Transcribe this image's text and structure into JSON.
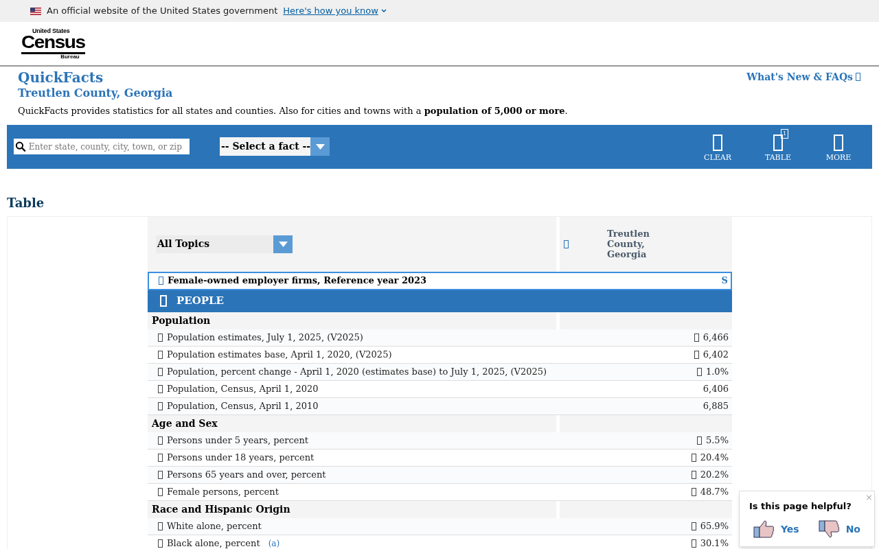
{
  "banner": {
    "text": "An official website of the United States government",
    "link": "Here's how you know"
  },
  "logo": {
    "top": "United States",
    "main": "Census",
    "bottom": "Bureau"
  },
  "header": {
    "title": "QuickFacts",
    "subtitle": "Treutlen County, Georgia",
    "whats_new": "What's New & FAQs",
    "description": "QuickFacts provides statistics for all states and counties. Also for cities and towns with a **population of 5,000 or more**."
  },
  "toolbar": {
    "search_placeholder": "Enter state, county, city, town, or zip",
    "fact_select": "-- Select a fact --",
    "buttons": [
      {
        "label": "CLEAR"
      },
      {
        "label": "TABLE",
        "badge": "1"
      },
      {
        "label": "MORE"
      }
    ]
  },
  "table": {
    "heading": "Table",
    "topic_select": "All Topics",
    "column": "Treutlen County, Georgia",
    "highlight": {
      "label": "Female-owned employer firms, Reference year 2023",
      "value": "S"
    },
    "section": "PEOPLE",
    "groups": [
      {
        "name": "Population",
        "rows": [
          {
            "label": "Population estimates, July 1, 2025, (V2025)",
            "value": "6,466",
            "flag": true
          },
          {
            "label": "Population estimates base, April 1, 2020, (V2025)",
            "value": "6,402",
            "flag": true
          },
          {
            "label": "Population, percent change - April 1, 2020 (estimates base) to July 1, 2025, (V2025)",
            "value": "1.0%",
            "flag": true
          },
          {
            "label": "Population, Census, April 1, 2020",
            "value": "6,406",
            "flag": false
          },
          {
            "label": "Population, Census, April 1, 2010",
            "value": "6,885",
            "flag": false
          }
        ]
      },
      {
        "name": "Age and Sex",
        "rows": [
          {
            "label": "Persons under 5 years, percent",
            "value": "5.5%",
            "flag": true
          },
          {
            "label": "Persons under 18 years, percent",
            "value": "20.4%",
            "flag": true
          },
          {
            "label": "Persons 65 years and over, percent",
            "value": "20.2%",
            "flag": true
          },
          {
            "label": "Female persons, percent",
            "value": "48.7%",
            "flag": true
          }
        ]
      },
      {
        "name": "Race and Hispanic Origin",
        "rows": [
          {
            "label": "White alone, percent",
            "value": "65.9%",
            "flag": true
          },
          {
            "label": "Black alone, percent",
            "value": "30.1%",
            "flag": true,
            "note": "(a)"
          }
        ]
      }
    ]
  },
  "feedback": {
    "question": "Is this page helpful?",
    "close": "×",
    "yes": "Yes",
    "no": "No"
  }
}
